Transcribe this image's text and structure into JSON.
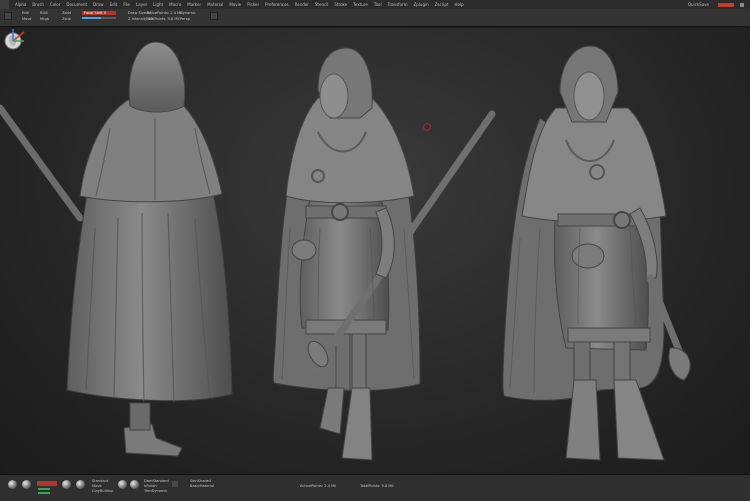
{
  "menu": {
    "items": [
      "Alpha",
      "Brush",
      "Color",
      "Document",
      "Draw",
      "Edit",
      "File",
      "Layer",
      "Light",
      "Macro",
      "Marker",
      "Material",
      "Movie",
      "Picker",
      "Preferences",
      "Render",
      "Stencil",
      "Stroke",
      "Texture",
      "Tool",
      "Transform",
      "Zplugin",
      "Zscript",
      "Help"
    ],
    "right_label": "QuickSave"
  },
  "shelf": {
    "group1": [
      "Edit",
      "Move"
    ],
    "group2": [
      "RGB",
      "Mrgb",
      "Zadd",
      "Zsub"
    ],
    "focal": "Focal Shift 0",
    "draw": "Draw Size 64",
    "intensity": "Z Intensity 25",
    "dynamic": "Dynamic",
    "persp": "Persp",
    "active_points": "ActivePoints: 2.4 Mil",
    "total_points": "TotalPoints: 9.8 Mil",
    "slider_fill_pct": 0.55
  },
  "viewport": {
    "figures": [
      "back view",
      "three-quarter view",
      "front view"
    ]
  },
  "bottom": {
    "labels": [
      "Standard",
      "Move",
      "ClayBuildup",
      "DamStandard",
      "hPolish",
      "TrimDynamic",
      "SkinShade4",
      "BasicMaterial"
    ],
    "info": "ActivePoints: 2.4 Mil",
    "info2": "TotalPoints: 9.8 Mil"
  },
  "colors": {
    "accent_red": "#b4362a",
    "accent_blue": "#4aa8e0",
    "accent_green": "#3aa55a",
    "clay": "#7a7a7a"
  }
}
